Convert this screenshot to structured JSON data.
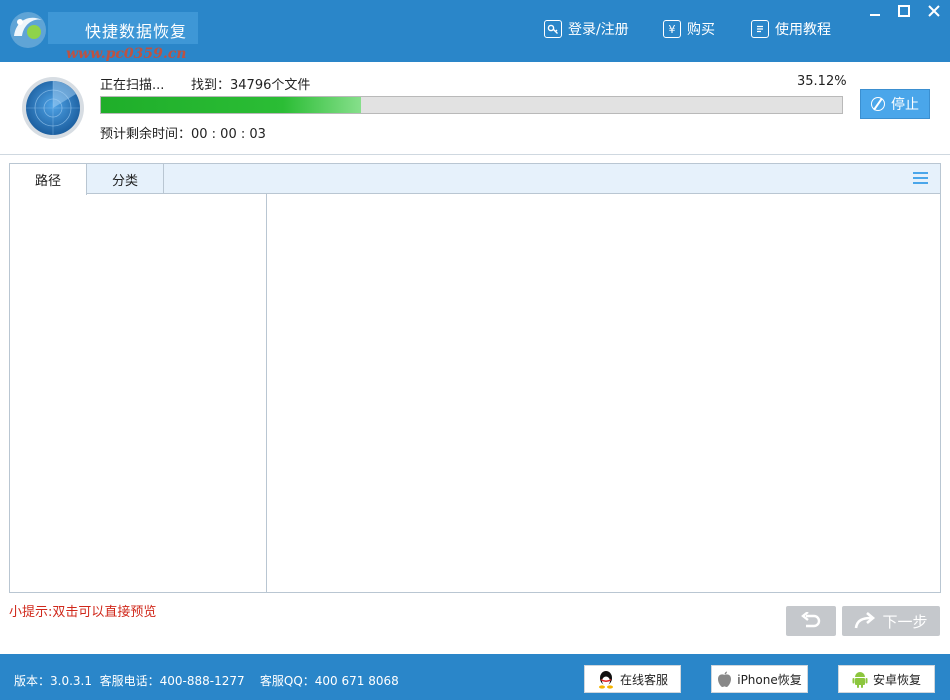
{
  "titlebar": {
    "app_title": "快捷数据恢复",
    "watermark": "www.pc0359.cn",
    "nav": {
      "login": "登录/注册",
      "buy": "购买",
      "buy_glyph": "¥",
      "tutorial": "使用教程"
    },
    "window_controls": {
      "minimize": "—",
      "maximize": "□",
      "close": "✕"
    }
  },
  "scan": {
    "status": "正在扫描...",
    "found": "找到：34796个文件",
    "percent_text": "35.12%",
    "progress_fraction": 0.3512,
    "time_left": "预计剩余时间：00 : 00 : 03",
    "stop_label": "停止"
  },
  "tabs": [
    {
      "label": "路径",
      "active": true
    },
    {
      "label": "分类",
      "active": false
    }
  ],
  "tip": "小提示:双击可以直接预览",
  "nav_buttons": {
    "next_label": "下一步"
  },
  "footer": {
    "info": "版本：3.0.3.1  客服电话：400-888-1277    客服QQ：400 671 8068",
    "online_service": "在线客服",
    "iphone_recovery": "iPhone恢复",
    "android_recovery": "安卓恢复"
  },
  "colors": {
    "brand_blue": "#2a86c9",
    "progress_green": "#1fae2a",
    "tip_red": "#d0281b",
    "button_blue": "#4aa6ea"
  }
}
